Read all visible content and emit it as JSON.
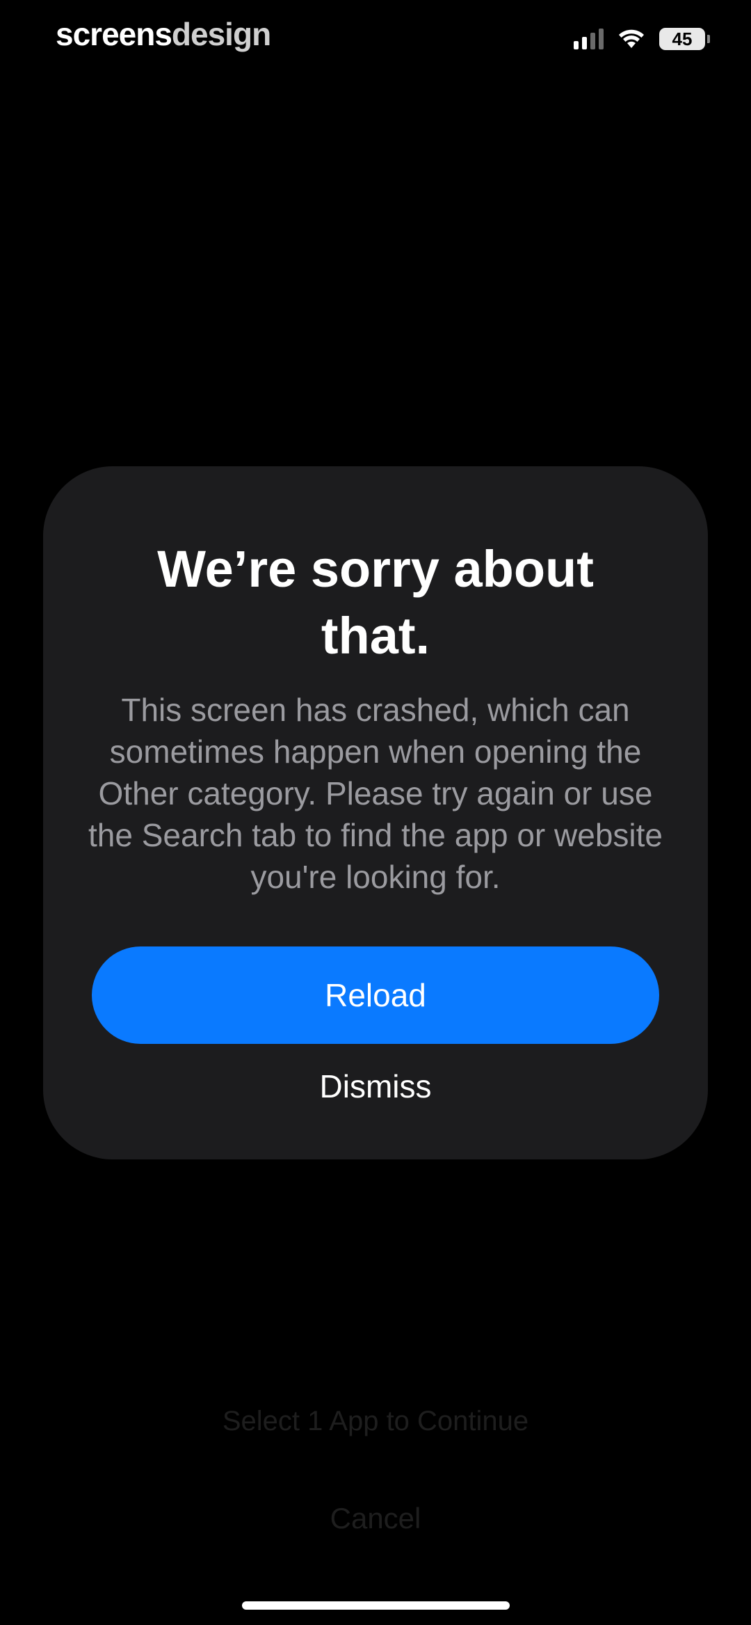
{
  "status_bar": {
    "brand_bold": "screens",
    "brand_light": "design",
    "battery_level": "45",
    "icons": [
      "signal-icon",
      "wifi-icon",
      "battery-icon"
    ]
  },
  "dialog": {
    "title": "We’re sorry about that.",
    "message": "This screen has crashed, which can sometimes happen when opening the Other category. Please try again or use the Search tab to find the app or website you're looking for.",
    "primary_button": "Reload",
    "secondary_button": "Dismiss"
  },
  "background": {
    "primary_action": "Select 1 App to Continue",
    "cancel_action": "Cancel"
  },
  "colors": {
    "accent": "#0a7aff",
    "dialog_background": "#1c1c1e",
    "page_background": "#000000",
    "message_text": "#9b9ba0"
  }
}
